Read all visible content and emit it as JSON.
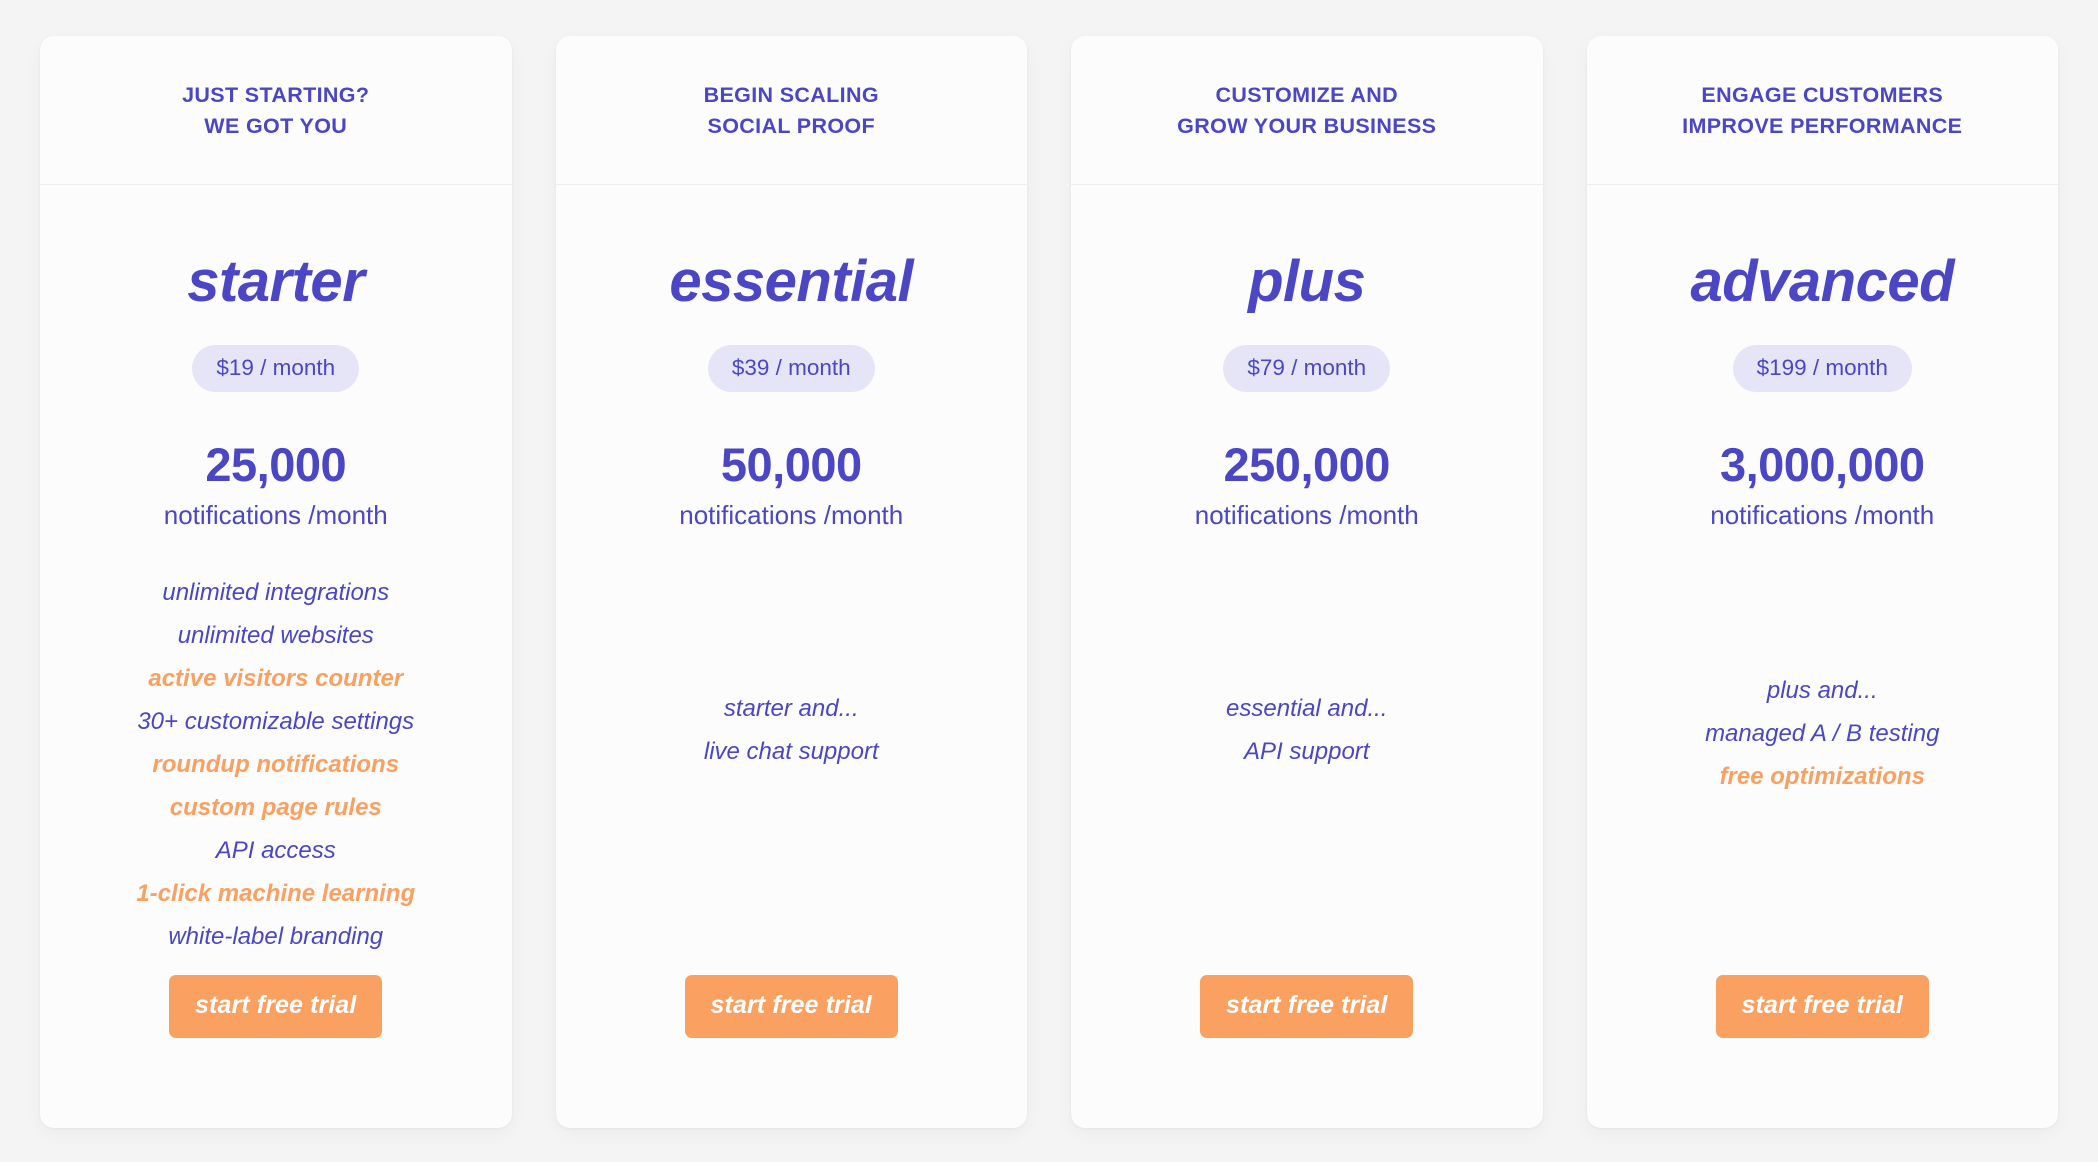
{
  "theme": {
    "page_background": "#f4f4f5",
    "card_background": "#fcfcfd",
    "brand_purple": "#4a46c4",
    "accent_orange": "#faa061",
    "pill_background": "#e6e5f7",
    "divider": "#eeeef2",
    "cta_text_color": "#ffffff"
  },
  "plans": [
    {
      "tagline": "JUST STARTING?\nWE GOT YOU",
      "name": "starter",
      "price": "$19 / month",
      "quota_number": "25,000",
      "quota_unit": "notifications /month",
      "features": [
        {
          "label": "unlimited integrations",
          "style": "base"
        },
        {
          "label": "unlimited websites",
          "style": "base"
        },
        {
          "label": "active visitors counter",
          "style": "accent"
        },
        {
          "label": "30+ customizable settings",
          "style": "base"
        },
        {
          "label": "roundup notifications",
          "style": "accent"
        },
        {
          "label": "custom page rules",
          "style": "accent"
        },
        {
          "label": "API access",
          "style": "base"
        },
        {
          "label": "1-click machine learning",
          "style": "accent"
        },
        {
          "label": "white-label branding",
          "style": "base"
        }
      ],
      "cta_label": "start free trial"
    },
    {
      "tagline": "BEGIN SCALING\nSOCIAL PROOF",
      "name": "essential",
      "price": "$39 / month",
      "quota_number": "50,000",
      "quota_unit": "notifications /month",
      "features": [
        {
          "label": "starter and...",
          "style": "base"
        },
        {
          "label": "live chat support",
          "style": "base"
        }
      ],
      "cta_label": "start free trial"
    },
    {
      "tagline": "CUSTOMIZE AND\nGROW YOUR BUSINESS",
      "name": "plus",
      "price": "$79 / month",
      "quota_number": "250,000",
      "quota_unit": "notifications /month",
      "features": [
        {
          "label": "essential and...",
          "style": "base"
        },
        {
          "label": "API support",
          "style": "base"
        }
      ],
      "cta_label": "start free trial"
    },
    {
      "tagline": "ENGAGE CUSTOMERS\nIMPROVE PERFORMANCE",
      "name": "advanced",
      "price": "$199 / month",
      "quota_number": "3,000,000",
      "quota_unit": "notifications /month",
      "features": [
        {
          "label": "plus and...",
          "style": "base"
        },
        {
          "label": "managed A / B testing",
          "style": "base"
        },
        {
          "label": "free optimizations",
          "style": "accent"
        }
      ],
      "cta_label": "start free trial"
    }
  ]
}
